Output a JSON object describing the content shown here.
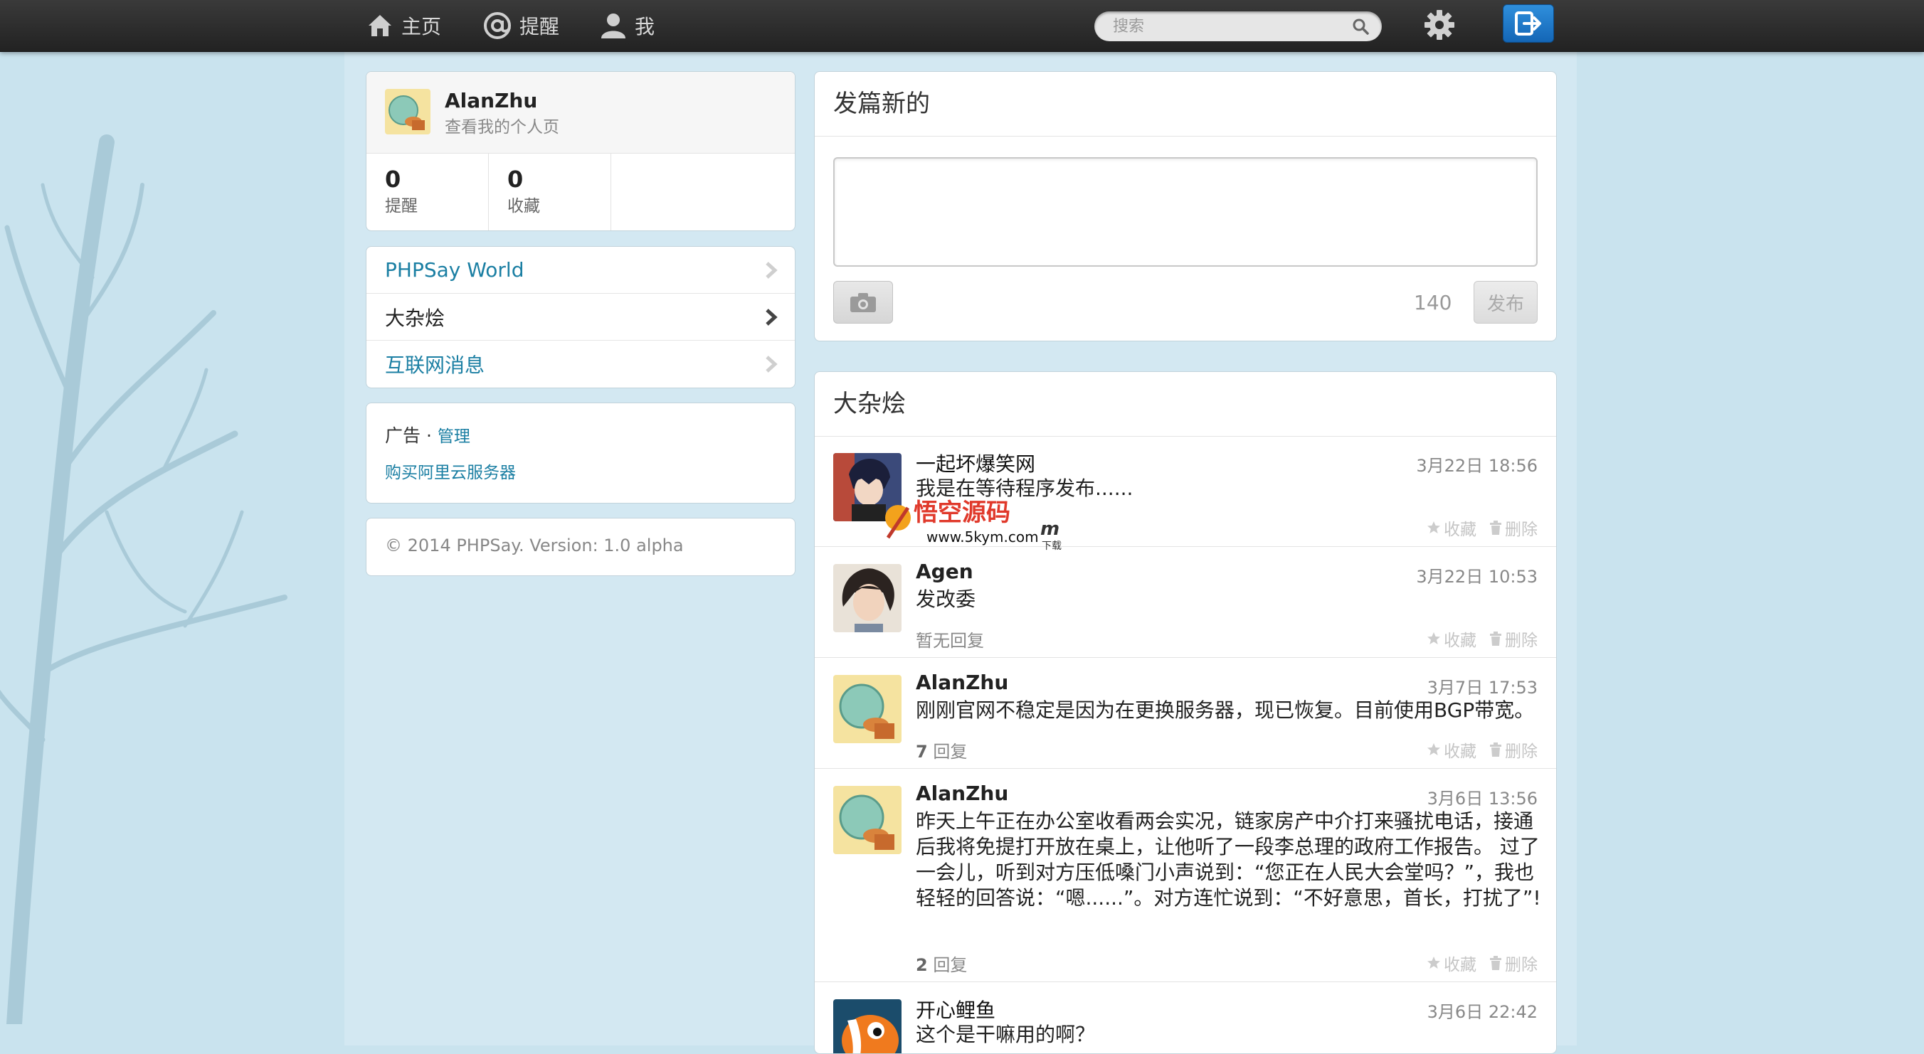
{
  "nav": {
    "home_label": "主页",
    "mentions_label": "提醒",
    "me_label": "我",
    "search_placeholder": "搜索"
  },
  "profile": {
    "name": "AlanZhu",
    "subtitle": "查看我的个人页",
    "stats": [
      {
        "value": "0",
        "label": "提醒"
      },
      {
        "value": "0",
        "label": "收藏"
      }
    ]
  },
  "topics": [
    {
      "label": "PHPSay World"
    },
    {
      "label": "大杂烩"
    },
    {
      "label": "互联网消息"
    }
  ],
  "ads": {
    "title": "广告 · ",
    "manage_label": "管理",
    "link_label": "购买阿里云服务器"
  },
  "footer": {
    "text": "© 2014 PHPSay. Version: 1.0 alpha"
  },
  "composer": {
    "title": "发篇新的",
    "char_count": "140",
    "publish_label": "发布"
  },
  "feed": {
    "title": "大杂烩",
    "favorite_label": "收藏",
    "delete_label": "删除",
    "posts": [
      {
        "author": "一起坏爆笑网",
        "time": "3月22日 18:56",
        "body": "我是在等待程序发布......",
        "replies": ""
      },
      {
        "author": "Agen",
        "time": "3月22日 10:53",
        "body": "发改委",
        "replies": "暂无回复"
      },
      {
        "author": "AlanZhu",
        "time": "3月7日 17:53",
        "body": "刚刚官网不稳定是因为在更换服务器，现已恢复。目前使用BGP带宽。",
        "reply_count": "7",
        "reply_suffix": " 回复"
      },
      {
        "author": "AlanZhu",
        "time": "3月6日 13:56",
        "body": "昨天上午正在办公室收看两会实况，链家房产中介打来骚扰电话，接通后我将免提打开放在桌上，让他听了一段李总理的政府工作报告。 过了一会儿，听到对方压低嗓门小声说到：“您正在人民大会堂吗？”，我也轻轻的回答说：“嗯......”。对方连忙说到：“不好意思，首长，打扰了”!",
        "reply_count": "2",
        "reply_suffix": " 回复"
      },
      {
        "author": "开心鲤鱼",
        "time": "3月6日 22:42",
        "body": "这个是干嘛用的啊？",
        "replies": ""
      }
    ]
  },
  "watermark": {
    "title": "悟空源码",
    "url": "www.5kym.com",
    "suffix": "m",
    "tag": "下载"
  },
  "colors": {
    "background": "#c9e3ee",
    "link": "#1b7fa3",
    "topbar": "#2a2a2a",
    "logout_button": "#1a73c4"
  }
}
